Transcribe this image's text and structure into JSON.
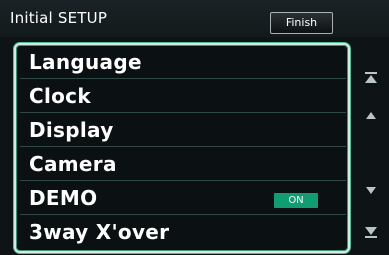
{
  "header": {
    "title": "Initial SETUP",
    "finish_label": "Finish"
  },
  "menu": {
    "items": [
      {
        "label": "Language"
      },
      {
        "label": "Clock"
      },
      {
        "label": "Display"
      },
      {
        "label": "Camera"
      },
      {
        "label": "DEMO",
        "toggle": "ON"
      },
      {
        "label": "3way X'over"
      }
    ]
  },
  "scroll": {
    "icons": [
      "scroll-top-icon",
      "scroll-up-icon",
      "scroll-down-icon",
      "scroll-bottom-icon"
    ]
  },
  "colors": {
    "accent": "#4fbf97",
    "toggle_on": "#119c72",
    "background": "#0e1416"
  }
}
